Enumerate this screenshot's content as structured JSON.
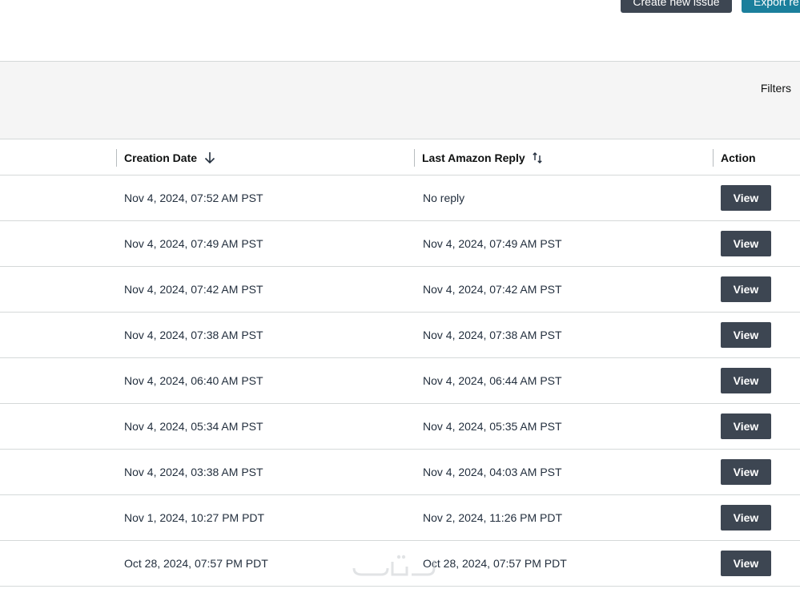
{
  "toolbar": {
    "create_label": "Create new issue",
    "export_label": "Export re"
  },
  "filters": {
    "label": "Filters"
  },
  "table": {
    "headers": {
      "creation_date": "Creation Date",
      "last_reply": "Last Amazon Reply",
      "action": "Action"
    },
    "sort": {
      "creation_date": "arrow-down-icon",
      "last_reply": "sort-up-down-icon"
    },
    "rows": [
      {
        "created": "Nov 4, 2024, 07:52 AM PST",
        "reply": "No reply",
        "action": "View"
      },
      {
        "created": "Nov 4, 2024, 07:49 AM PST",
        "reply": "Nov 4, 2024, 07:49 AM PST",
        "action": "View"
      },
      {
        "created": "Nov 4, 2024, 07:42 AM PST",
        "reply": "Nov 4, 2024, 07:42 AM PST",
        "action": "View"
      },
      {
        "created": "Nov 4, 2024, 07:38 AM PST",
        "reply": "Nov 4, 2024, 07:38 AM PST",
        "action": "View"
      },
      {
        "created": "Nov 4, 2024, 06:40 AM PST",
        "reply": "Nov 4, 2024, 06:44 AM PST",
        "action": "View"
      },
      {
        "created": "Nov 4, 2024, 05:34 AM PST",
        "reply": "Nov 4, 2024, 05:35 AM PST",
        "action": "View"
      },
      {
        "created": "Nov 4, 2024, 03:38 AM PST",
        "reply": "Nov 4, 2024, 04:03 AM PST",
        "action": "View"
      },
      {
        "created": "Nov 1, 2024, 10:27 PM PDT",
        "reply": "Nov 2, 2024, 11:26 PM PDT",
        "action": "View"
      },
      {
        "created": "Oct 28, 2024, 07:57 PM PDT",
        "reply": "Oct 28, 2024, 07:57 PM PDT",
        "action": "View"
      }
    ]
  },
  "colors": {
    "dark_button": "#3d4652",
    "teal_button": "#1b7f9c",
    "filter_bar": "#f5f5f5",
    "border": "#d5d9d9"
  }
}
